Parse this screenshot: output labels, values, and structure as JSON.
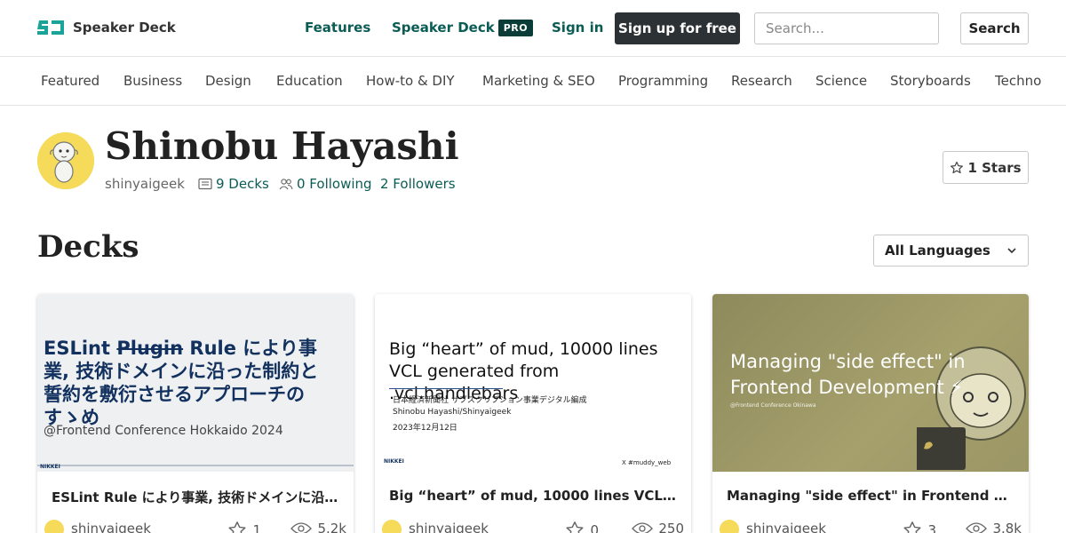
{
  "header": {
    "logo_text": "Speaker Deck",
    "nav_features": "Features",
    "nav_speakerdeck_pro": "Speaker Deck",
    "pro_badge": "PRO",
    "nav_signin": "Sign in",
    "signup_label": "Sign up for free",
    "search_placeholder": "Search...",
    "search_button": "Search"
  },
  "categories": [
    "Featured",
    "Business",
    "Design",
    "Education",
    "How-to & DIY",
    "Marketing & SEO",
    "Programming",
    "Research",
    "Science",
    "Storyboards",
    "Techno"
  ],
  "profile": {
    "name": "Shinobu Hayashi",
    "handle": "shinyaigeek",
    "decks": "9 Decks",
    "following": "0 Following",
    "followers": "2 Followers",
    "stars": "1 Stars"
  },
  "decks_section": {
    "title": "Decks",
    "language_filter": "All Languages"
  },
  "cards": [
    {
      "thumb_title_a": "ESLint ",
      "thumb_title_strike": "Plugin",
      "thumb_title_b": " Rule により事業, 技術ドメインに沿った制約と誓約を敷衍させるアプローチのすゝめ",
      "thumb_sub": "@Frontend Conference Hokkaido 2024",
      "thumb_footer": "NIKKEI",
      "title": "ESLint Rule により事業, 技術ドメインに沿...",
      "user": "shinyaigeek",
      "stars": "1",
      "views": "5.2k"
    },
    {
      "thumb_title": "Big “heart” of mud, 10000 lines VCL generated from .vcl.handlebars",
      "thumb_org": "日本経済新聞社 サブスクリプション事業デジタル編成",
      "thumb_author": "Shinobu Hayashi/Shinyaigeek",
      "thumb_date": "2023年12月12日",
      "thumb_footer": "NIKKEI",
      "thumb_hashtag": "X  #muddy_web",
      "title": "Big “heart” of mud, 10000 lines VCL gener...",
      "user": "shinyaigeek",
      "stars": "0",
      "views": "250"
    },
    {
      "thumb_title": "Managing \"side effect\" in Frontend Development ⚡",
      "thumb_sub": "@Frontend Conference Okinawa",
      "title": "Managing \"side effect\" in Frontend Devel...",
      "user": "shinyaigeek",
      "stars": "3",
      "views": "3.8k"
    }
  ],
  "colors": {
    "accent": "#0b5c54",
    "dark_button": "#2b3134",
    "avatar_yellow": "#f6da5a"
  }
}
